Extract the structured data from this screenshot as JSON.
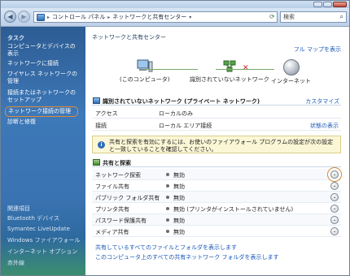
{
  "addressbar": {
    "segments": [
      "コントロール パネル",
      "ネットワークと共有センター"
    ],
    "search_placeholder": "検索"
  },
  "sidebar": {
    "tasks_heading": "タスク",
    "tasks": [
      "コンピュータとデバイスの表示",
      "ネットワークに接続",
      "ワイヤレス ネットワークの管理",
      "接続またはネットワークのセットアップ",
      "ネットワーク接続の管理",
      "診断と修復"
    ],
    "related_heading": "関連項目",
    "related": [
      "Bluetooth デバイス",
      "Symantec LiveUpdate",
      "Windows ファイアウォール",
      "インターネット オプション",
      "赤外線"
    ]
  },
  "main": {
    "title": "ネットワークと共有センター",
    "full_map_link": "フル マップを表示",
    "map_nodes": {
      "computer": "(このコンピュータ)",
      "network": "識別されていないネットワーク",
      "internet": "インターネット"
    },
    "network_section": {
      "title": "識別されていないネットワーク (プライベート ネットワーク)",
      "customize": "カスタマイズ",
      "rows": [
        {
          "label": "アクセス",
          "value": "ローカルのみ",
          "link": ""
        },
        {
          "label": "接続",
          "value": "ローカル エリア接続",
          "link": "状態の表示"
        }
      ]
    },
    "info_text": "共有と探索を有効にするには、お使いのファイアウォール プログラムの設定が次の設定と一致していることを確認してください。",
    "sharing_section": {
      "title": "共有と探索",
      "rows": [
        {
          "label": "ネットワーク探索",
          "value": "無効"
        },
        {
          "label": "ファイル共有",
          "value": "無効"
        },
        {
          "label": "パブリック フォルダ共有",
          "value": "無効"
        },
        {
          "label": "プリンタ共有",
          "value": "無効 (プリンタがインストールされていません)"
        },
        {
          "label": "パスワード保護共有",
          "value": "無効"
        },
        {
          "label": "メディア共有",
          "value": "無効"
        }
      ]
    },
    "bottom_links": [
      "共有しているすべてのファイルとフォルダを表示します",
      "このコンピュータ上のすべての共有ネットワーク フォルダを表示します"
    ]
  }
}
